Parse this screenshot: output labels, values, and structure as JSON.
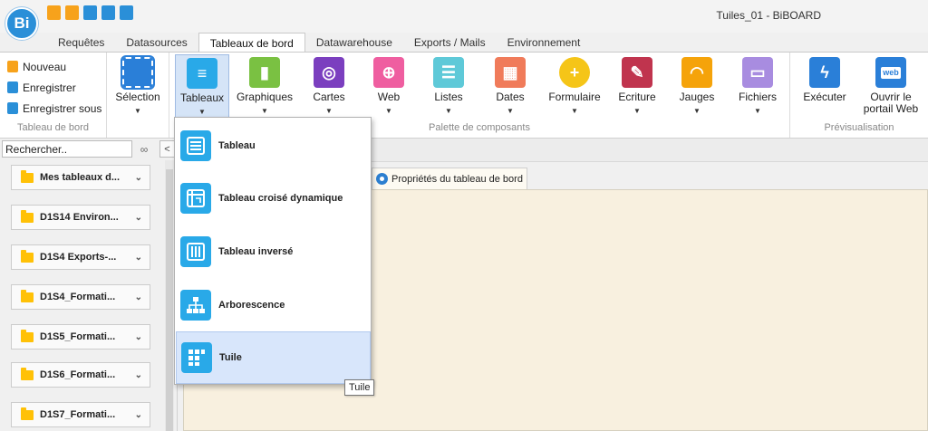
{
  "app": {
    "logo_text": "Bi",
    "window_title": "Tuiles_01 - BiBOARD"
  },
  "qat": [
    {
      "icon": "new-file-icon",
      "color": "#f7a21b"
    },
    {
      "icon": "new-folder-icon",
      "color": "#f7a21b"
    },
    {
      "icon": "save-icon",
      "color": "#2a8fd8"
    },
    {
      "icon": "edit-icon",
      "color": "#2a8fd8"
    },
    {
      "icon": "window-icon",
      "color": "#2a8fd8"
    }
  ],
  "tabs": [
    "Requêtes",
    "Datasources",
    "Tableaux de bord",
    "Datawarehouse",
    "Exports / Mails",
    "Environnement"
  ],
  "active_tab": "Tableaux de bord",
  "ribbon": {
    "file_group": {
      "items": [
        "Nouveau",
        "Enregistrer",
        "Enregistrer sous"
      ],
      "label": "Tableau de bord"
    },
    "selection": {
      "label": "Sélection"
    },
    "palette": {
      "label": "Palette de composants",
      "buttons": [
        {
          "label": "Tableaux",
          "icon": "table-icon",
          "color": "#29a9e8"
        },
        {
          "label": "Graphiques",
          "icon": "bar-chart-icon",
          "color": "#7ac142"
        },
        {
          "label": "Cartes",
          "icon": "globe-icon",
          "color": "#7b3fbf"
        },
        {
          "label": "Web",
          "icon": "web-icon",
          "color": "#ef5ea0"
        },
        {
          "label": "Listes",
          "icon": "list-icon",
          "color": "#5ec9d8"
        },
        {
          "label": "Dates",
          "icon": "calendar-icon",
          "color": "#f07b5a"
        },
        {
          "label": "Formulaire",
          "icon": "form-icon",
          "color": "#f5c518"
        },
        {
          "label": "Ecriture",
          "icon": "pen-icon",
          "color": "#c0344e"
        },
        {
          "label": "Jauges",
          "icon": "gauge-icon",
          "color": "#f5a30a"
        },
        {
          "label": "Fichiers",
          "icon": "folder-icon",
          "color": "#a88ce0"
        }
      ]
    },
    "preview": {
      "label": "Prévisualisation",
      "execute": "Exécuter",
      "portal_line1": "Ouvrir le",
      "portal_line2": "portail Web",
      "portal_icon_text": "web"
    }
  },
  "left_panel": {
    "search_value": "Rechercher..",
    "folders": [
      "Mes tableaux d...",
      "D1S14 Environ...",
      "D1S4 Exports-...",
      "D1S4_Formati...",
      "D1S5_Formati...",
      "D1S6_Formati...",
      "D1S7_Formati..."
    ]
  },
  "main": {
    "doc_tab_label": "Propriétés du tableau de bord"
  },
  "dropdown": {
    "items": [
      "Tableau",
      "Tableau croisé dynamique",
      "Tableau inversé",
      "Arborescence",
      "Tuile"
    ],
    "hovered": "Tuile"
  },
  "tooltip": "Tuile"
}
